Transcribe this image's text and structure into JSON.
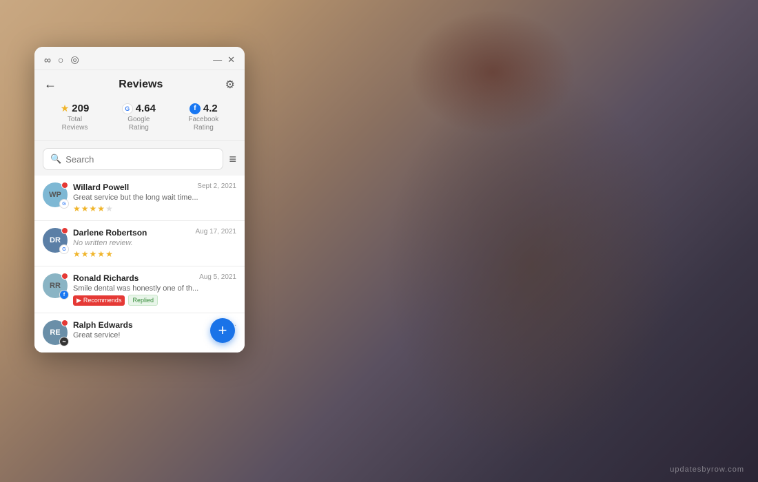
{
  "background": {
    "watermark": "updatesbyrow.com"
  },
  "titlebar": {
    "icon1": "∞",
    "icon2": "○",
    "icon3": "◎",
    "minimize": "—",
    "close": "✕"
  },
  "header": {
    "back_label": "←",
    "title": "Reviews",
    "settings_label": "⚙"
  },
  "stats": [
    {
      "icon_type": "star",
      "number": "209",
      "label": "Total\nReviews"
    },
    {
      "icon_type": "google",
      "number": "4.64",
      "label": "Google\nRating"
    },
    {
      "icon_type": "facebook",
      "number": "4.2",
      "label": "Facebook\nRating"
    }
  ],
  "search": {
    "placeholder": "Search",
    "filter_icon": "≡"
  },
  "reviews": [
    {
      "name": "Willard Powell",
      "date": "Sept 2, 2021",
      "text": "Great service but the long wait time...",
      "stars": 4,
      "source": "google",
      "avatar_initials": "WP",
      "avatar_class": "av-wp",
      "italic": false,
      "tags": []
    },
    {
      "name": "Darlene Robertson",
      "date": "Aug 17, 2021",
      "text": "No written review.",
      "stars": 5,
      "source": "google",
      "avatar_initials": "DR",
      "avatar_class": "av-dr",
      "italic": true,
      "tags": []
    },
    {
      "name": "Ronald Richards",
      "date": "Aug 5, 2021",
      "text": "Smile dental was honestly one of th...",
      "stars": 0,
      "source": "facebook",
      "avatar_initials": "RR",
      "avatar_class": "av-rr",
      "italic": false,
      "tags": [
        "Recommends",
        "Replied"
      ]
    },
    {
      "name": "Ralph Edwards",
      "date": "Ju...",
      "text": "Great service!",
      "stars": 0,
      "source": "other",
      "avatar_initials": "RE",
      "avatar_class": "av-re",
      "italic": false,
      "tags": []
    }
  ],
  "fab": {
    "label": "+"
  }
}
